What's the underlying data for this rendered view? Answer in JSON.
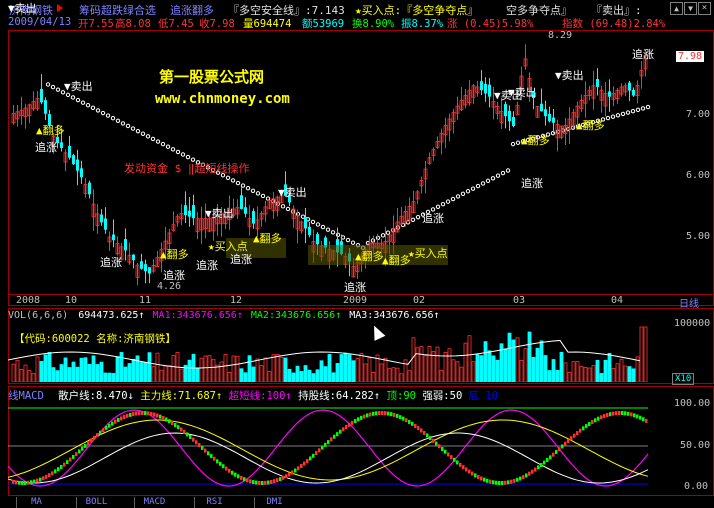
{
  "header": {
    "stock_name": "济南钢铁",
    "formula_name": "筹码超跌绿合选",
    "formula_sub": "追涨翻多",
    "indicator_line": "『多空安全线』:7.143",
    "buy_point": "★买入点:『多空争夺点』",
    "buy_point2": "空多争夺点』",
    "sell_point": "『卖出』:",
    "date": "2009/04/13",
    "open": "开7.55",
    "high": "高8.08",
    "low": "低7.45",
    "close": "收7.98",
    "volume": "量694474",
    "amount": "额53969",
    "turnover": "换8.90%",
    "amplitude": "振8.37%",
    "change": "涨 (0.45)5.98%",
    "index": "指数 (69.48)2.84%",
    "colors": {
      "up": "#ff3232",
      "down": "#00ffff",
      "yellow": "#ffff00",
      "magenta": "#ff00ff",
      "green": "#00ff00",
      "white": "#ffffff",
      "blue": "#0000ff",
      "accent": "#8080ff"
    }
  },
  "main_chart": {
    "watermark_title": "第一股票公式网",
    "watermark_url": "www.chnmoney.com",
    "annotation_red": "发动资金 $ ‖超短线操作 ",
    "price_labels": [
      "8.29",
      "4.26"
    ],
    "y_ticks": [
      "7.98",
      "7.00",
      "6.00",
      "5.00"
    ],
    "x_ticks": [
      "2008",
      "10",
      "11",
      "12",
      "2009",
      "02",
      "03",
      "04"
    ],
    "period_label": "日线",
    "signals": [
      {
        "text": "卖出",
        "type": "sell"
      },
      {
        "text": "翻多",
        "type": "flip"
      },
      {
        "text": "追涨",
        "type": "chase"
      },
      {
        "text": "卖出",
        "type": "sell"
      },
      {
        "text": "卖出",
        "type": "sell"
      },
      {
        "text": "翻多",
        "type": "flip"
      },
      {
        "text": "追涨",
        "type": "chase"
      },
      {
        "text": "追涨",
        "type": "chase"
      },
      {
        "text": "追涨",
        "type": "chase"
      },
      {
        "text": "翻多",
        "type": "flip"
      },
      {
        "text": "追涨",
        "type": "chase"
      },
      {
        "text": "翻多",
        "type": "flip"
      },
      {
        "text": "追涨",
        "type": "chase"
      },
      {
        "text": "追涨",
        "type": "chase"
      },
      {
        "text": "买入点",
        "type": "buy"
      },
      {
        "text": "翻多",
        "type": "flip"
      },
      {
        "text": "买入点",
        "type": "buy"
      },
      {
        "text": "追涨",
        "type": "chase"
      },
      {
        "text": "卖出",
        "type": "sell"
      },
      {
        "text": "卖出",
        "type": "sell"
      },
      {
        "text": "卖出",
        "type": "sell"
      },
      {
        "text": "翻多",
        "type": "flip"
      },
      {
        "text": "翻多",
        "type": "flip"
      },
      {
        "text": "追涨",
        "type": "chase"
      },
      {
        "text": "卖出",
        "type": "sell"
      }
    ]
  },
  "volume_panel": {
    "title": "VOL(6,6,6)",
    "vol": "694473.625",
    "ma1": "MA1:343676.656",
    "ma2": "MA2:343676.656",
    "ma3": "MA3:343676.656",
    "code_label": "【代码:600022 名称:济南钢铁】",
    "y_tick": "100000",
    "unit": "X10"
  },
  "macd_panel": {
    "title": "线MACD",
    "retail": "散户线:8.470",
    "main": "主力线:71.687",
    "short": "超短线:100",
    "hold": "持股线:64.282",
    "top": "顶:90",
    "strength": "强弱:50",
    "low": "底 10",
    "y_ticks": [
      "100.00",
      "50.00",
      "0.00"
    ]
  },
  "bottom_tabs": [
    "MA",
    "BOLL",
    "MACD",
    "RSI",
    "DMI"
  ]
}
